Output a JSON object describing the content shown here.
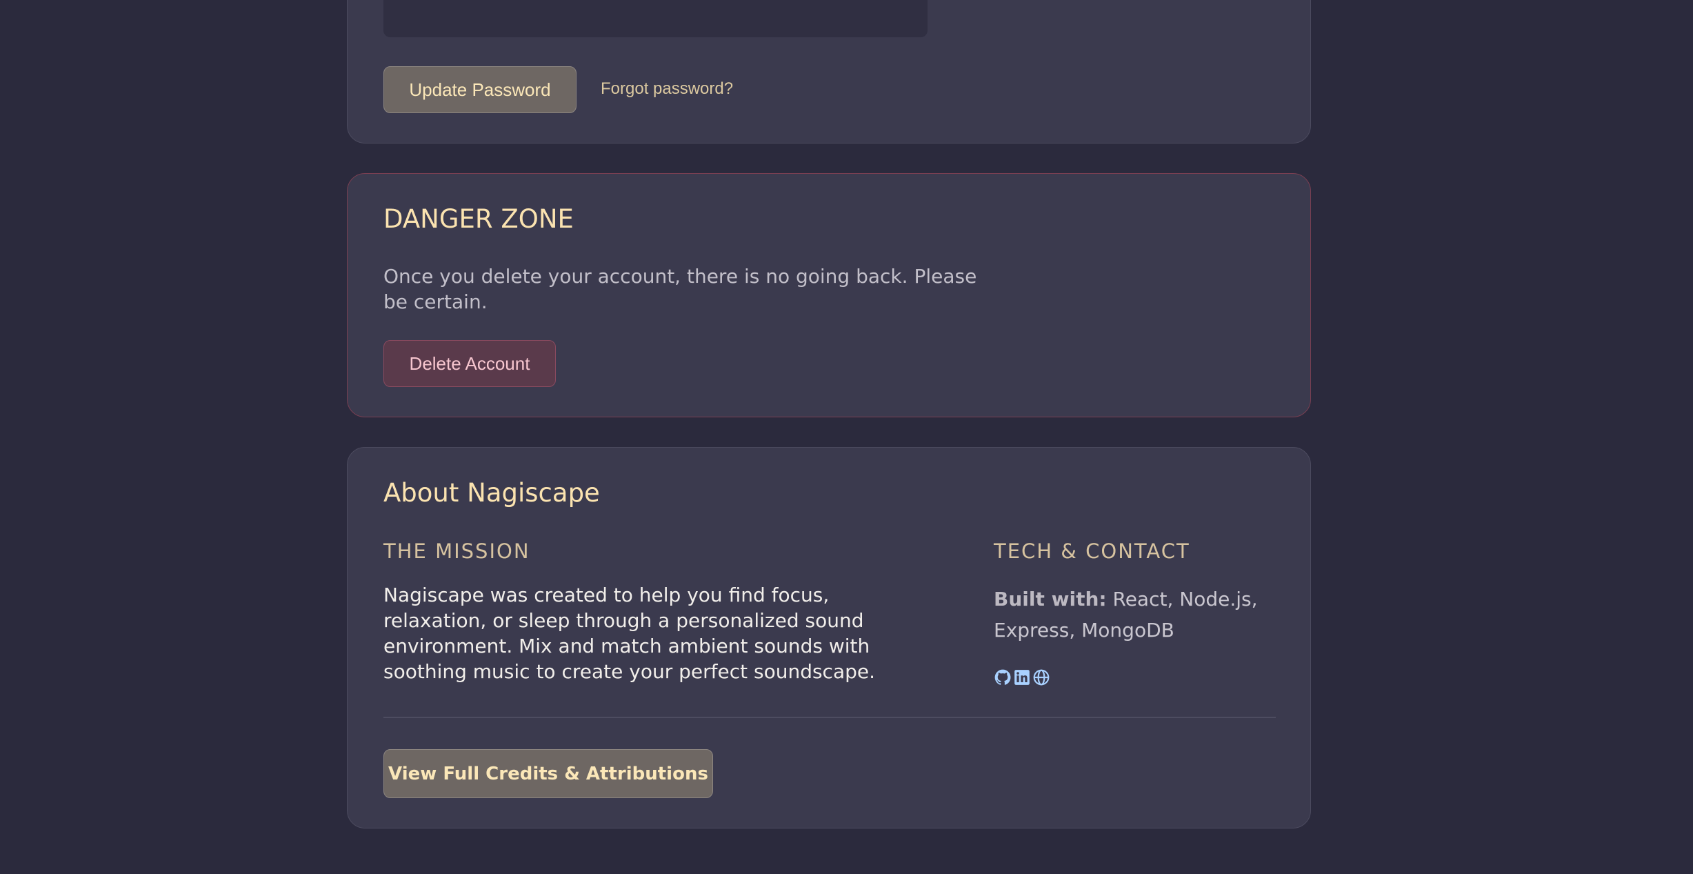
{
  "password": {
    "update_label": "Update Password",
    "forgot_label": "Forgot password?"
  },
  "danger": {
    "title": "DANGER ZONE",
    "text": "Once you delete your account, there is no going back. Please be certain.",
    "delete_label": "Delete Account"
  },
  "about": {
    "title": "About Nagiscape",
    "mission_heading": "THE MISSION",
    "mission_text": "Nagiscape was created to help you find focus, relaxation, or sleep through a personalized sound environment. Mix and match ambient sounds with soothing music to create your perfect soundscape.",
    "tech_heading": "TECH & CONTACT",
    "built_with_label": "Built with:",
    "built_with_value": "React, Node.js, Express, MongoDB",
    "icons": [
      "github-icon",
      "linkedin-icon",
      "globe-icon"
    ],
    "credits_label": "View Full Credits & Attributions"
  },
  "colors": {
    "background": "#2b2a3d",
    "card": "#3b3a4e",
    "accent": "#fbe3b0",
    "danger_border": "#7a3f52",
    "icon": "#a9d1ff"
  }
}
